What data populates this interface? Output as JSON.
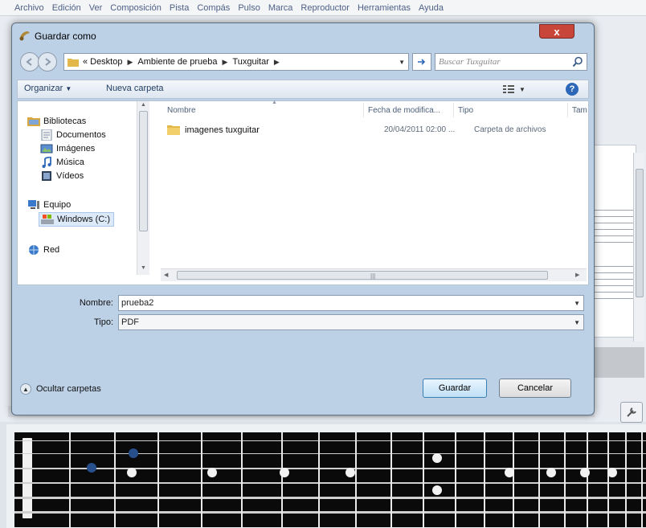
{
  "app": {
    "menu": [
      "Archivo",
      "Edición",
      "Ver",
      "Composición",
      "Pista",
      "Compás",
      "Pulso",
      "Marca",
      "Reproductor",
      "Herramientas",
      "Ayuda"
    ]
  },
  "dialog": {
    "title": "Guardar como",
    "close_label": "x",
    "breadcrumb": [
      "«",
      "Desktop",
      "Ambiente de prueba",
      "Tuxguitar"
    ],
    "search_placeholder": "Buscar Tuxguitar",
    "toolbar": {
      "organize": "Organizar",
      "new_folder": "Nueva carpeta",
      "help": "?"
    },
    "sidebar": [
      {
        "label": "Bibliotecas",
        "icon": "library-icon"
      },
      {
        "label": "Documentos",
        "icon": "documents-icon"
      },
      {
        "label": "Imágenes",
        "icon": "pictures-icon"
      },
      {
        "label": "Música",
        "icon": "music-icon"
      },
      {
        "label": "Vídeos",
        "icon": "videos-icon"
      },
      {
        "label": "Equipo",
        "icon": "computer-icon"
      },
      {
        "label": "Windows (C:)",
        "icon": "drive-icon"
      },
      {
        "label": "Red",
        "icon": "network-icon"
      }
    ],
    "columns": {
      "name": "Nombre",
      "modified": "Fecha de modifica...",
      "type": "Tipo",
      "size": "Tam"
    },
    "files": [
      {
        "name": "imagenes tuxguitar",
        "modified": "20/04/2011 02:00 ...",
        "type": "Carpeta de archivos",
        "icon": "folder-icon"
      }
    ],
    "filename_label": "Nombre:",
    "filename_value": "prueba2",
    "filetype_label": "Tipo:",
    "filetype_value": "PDF",
    "hide_folders": "Ocultar carpetas",
    "save_label": "Guardar",
    "cancel_label": "Cancelar"
  },
  "colors": {
    "dialog_frame": "#bcd0e6",
    "accent": "#3c7fb1",
    "close_button": "#c8453a",
    "fretboard": "#0a0a0a",
    "note": "#264f8c"
  }
}
